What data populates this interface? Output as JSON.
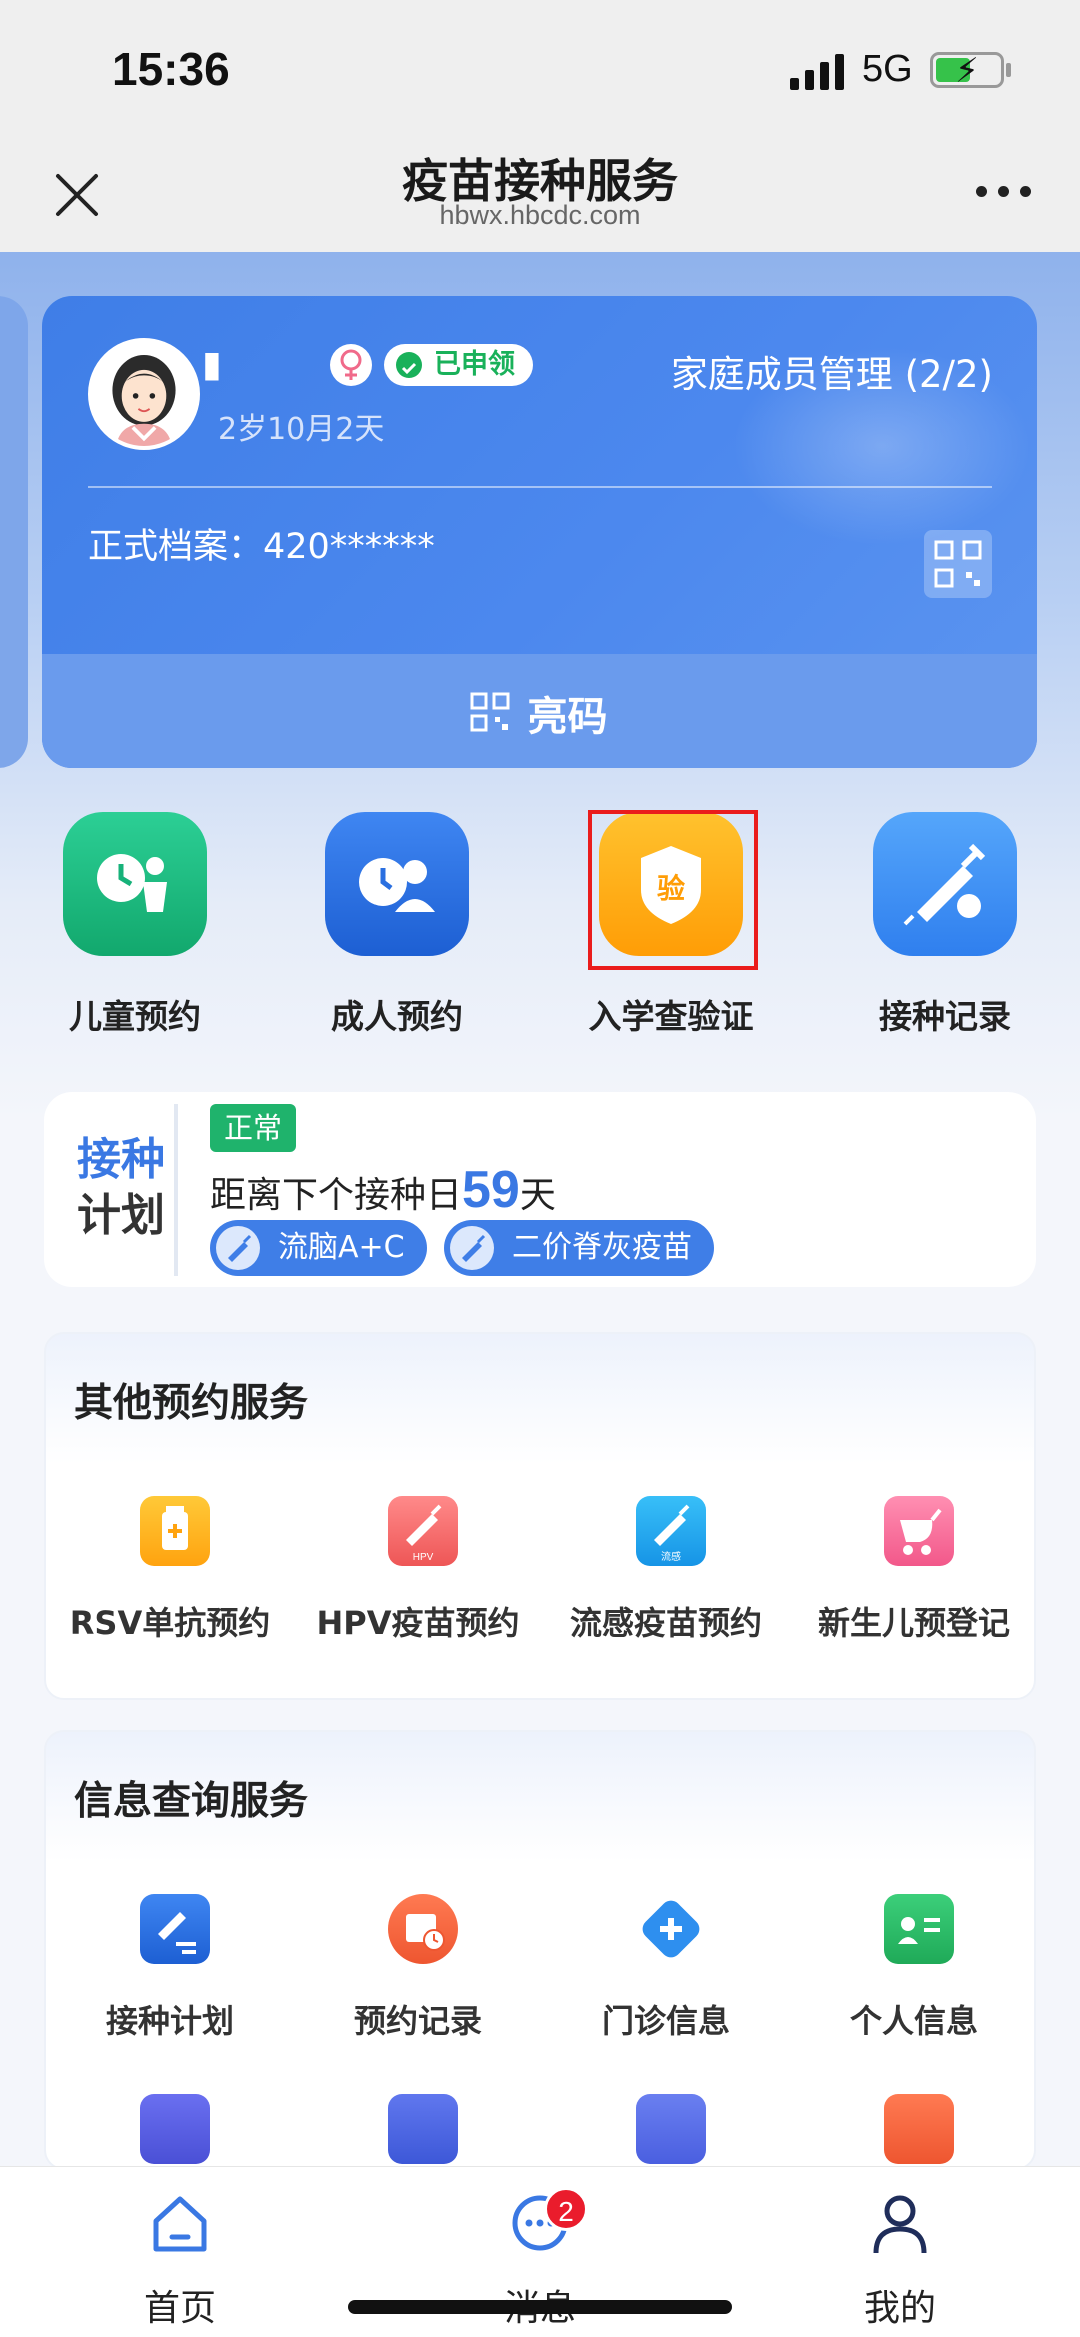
{
  "status_bar": {
    "time": "15:36",
    "network": "5G"
  },
  "nav": {
    "title": "疫苗接种服务",
    "url": "hbwx.hbcdc.com"
  },
  "member_card": {
    "name": "▮",
    "claimed_badge": "已申领",
    "age": "2岁10月2天",
    "family_link": "家庭成员管理 (2/2)",
    "record_label": "正式档案：420******",
    "show_code": "亮码"
  },
  "quick_actions": [
    {
      "label": "儿童预约",
      "color": "#17b27a"
    },
    {
      "label": "成人预约",
      "color": "#2a6fe0"
    },
    {
      "label": "入学查验证",
      "color": "#ffad12",
      "icon_text": "验"
    },
    {
      "label": "接种记录",
      "color": "#3b8ef2"
    }
  ],
  "plan": {
    "title_top": "接种",
    "title_bottom": "计划",
    "status": "正常",
    "countdown_prefix": "距离下个接种日",
    "countdown_days": "59",
    "countdown_suffix": "天",
    "vaccines": [
      "流脑A+C",
      "二价脊灰疫苗"
    ]
  },
  "other_services": {
    "title": "其他预约服务",
    "items": [
      {
        "label": "RSV单抗预约",
        "color": "#ffb21c"
      },
      {
        "label": "HPV疫苗预约",
        "color": "#f26a6a",
        "icon_text": "HPV"
      },
      {
        "label": "流感疫苗预约",
        "color": "#22a7f0",
        "icon_text": "流感"
      },
      {
        "label": "新生儿预登记",
        "color": "#f56b9a"
      }
    ]
  },
  "info_services": {
    "title": "信息查询服务",
    "items": [
      {
        "label": "接种计划",
        "color": "#2a6fe0"
      },
      {
        "label": "预约记录",
        "color": "#f3653f"
      },
      {
        "label": "门诊信息",
        "color": "#2e8fef"
      },
      {
        "label": "个人信息",
        "color": "#2cb665"
      }
    ],
    "more_icons": [
      {
        "color": "#5a5fe0"
      },
      {
        "color": "#4f67e0"
      },
      {
        "color": "#5a6fe6"
      },
      {
        "color": "#f3653f"
      }
    ]
  },
  "tab_bar": {
    "tabs": [
      {
        "label": "首页"
      },
      {
        "label": "消息",
        "badge": "2"
      },
      {
        "label": "我的"
      }
    ]
  }
}
